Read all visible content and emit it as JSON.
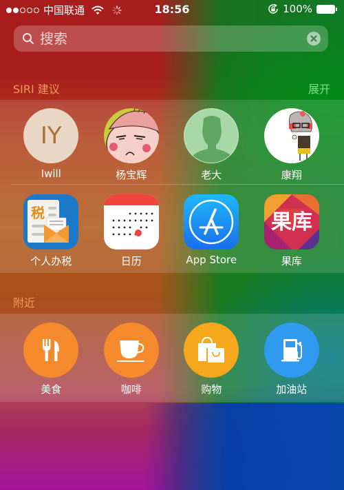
{
  "status_bar": {
    "signal_dots_filled": 2,
    "signal_dots_total": 5,
    "carrier": "中国联通",
    "wifi_icon": "wifi-icon",
    "activity_icon": "activity-spinner-icon",
    "time": "18:56",
    "rotation_lock_icon": "rotation-lock-icon",
    "battery_percent": "100%",
    "battery_level": 1.0
  },
  "search": {
    "placeholder": "搜索",
    "value": "",
    "search_icon": "search-icon",
    "clear_icon": "clear-icon"
  },
  "siri_suggestions": {
    "title": "SIRI 建议",
    "expand_label": "展开",
    "contacts": [
      {
        "name": "Iwill",
        "initials": "IY",
        "avatar": "initials"
      },
      {
        "name": "杨宝辉",
        "avatar": "cartoon-face"
      },
      {
        "name": "老大",
        "avatar": "default-silhouette"
      },
      {
        "name": "康翔",
        "avatar": "cartoon-girl"
      }
    ],
    "apps": [
      {
        "name": "个人办税",
        "icon": "tax-app-icon",
        "glyph": "税"
      },
      {
        "name": "日历",
        "icon": "calendar-app-icon"
      },
      {
        "name": "App Store",
        "icon": "app-store-icon"
      },
      {
        "name": "果库",
        "icon": "guoku-app-icon",
        "glyph": "果库"
      }
    ]
  },
  "nearby": {
    "title": "附近",
    "items": [
      {
        "name": "美食",
        "icon": "fork-knife-icon",
        "color": "#f58a2c"
      },
      {
        "name": "咖啡",
        "icon": "coffee-cup-icon",
        "color": "#f58a2c"
      },
      {
        "name": "购物",
        "icon": "shopping-bag-icon",
        "color": "#f5a81c"
      },
      {
        "name": "加油站",
        "icon": "gas-pump-icon",
        "color": "#2f9af0"
      }
    ]
  },
  "colors": {
    "section_title": "#f29a5c",
    "expand_link": "#7be08a",
    "calendar_red": "#f0453a",
    "app_store_blue": "#1a8af0"
  }
}
